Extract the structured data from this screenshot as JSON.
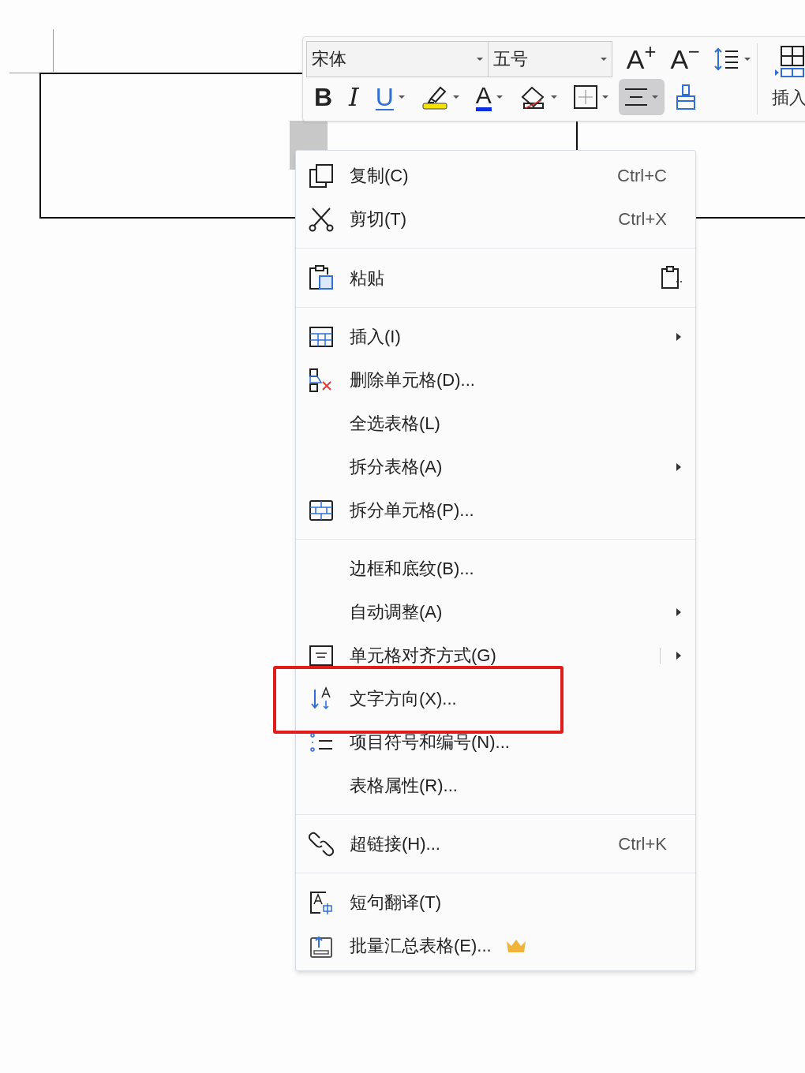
{
  "toolbar": {
    "font": {
      "value": "宋体"
    },
    "size": {
      "value": "五号"
    },
    "row1": [
      {
        "kind": "grow_font",
        "glyph": "A$^{+}$",
        "dropdown": false,
        "selected": false
      },
      {
        "kind": "shrink_font",
        "glyph": "A$^{−}$",
        "dropdown": false,
        "selected": false
      },
      {
        "kind": "line_spacing",
        "dropdown": true,
        "selected": false
      }
    ],
    "row2": [
      {
        "kind": "bold",
        "glyph": "B",
        "dropdown": false,
        "selected": false
      },
      {
        "kind": "italic",
        "glyph": "I",
        "dropdown": false,
        "selected": false
      },
      {
        "kind": "underline",
        "glyph": "U",
        "dropdown": true,
        "selected": false
      },
      {
        "kind": "highlight",
        "dropdown": true,
        "selected": false
      },
      {
        "kind": "font_color",
        "glyph": "A",
        "dropdown": true,
        "selected": false
      },
      {
        "kind": "clear_format",
        "dropdown": true,
        "selected": false
      },
      {
        "kind": "borders",
        "dropdown": true,
        "selected": false
      },
      {
        "kind": "align",
        "dropdown": true,
        "selected": true
      },
      {
        "kind": "format_painter",
        "dropdown": false,
        "selected": false
      }
    ],
    "insert": {
      "label": "插入"
    }
  },
  "menu": [
    {
      "kind": "copy",
      "label": "复制(C)",
      "shortcut": "Ctrl+C"
    },
    {
      "kind": "cut",
      "label": "剪切(T)",
      "shortcut": "Ctrl+X"
    },
    {
      "kind": "separator"
    },
    {
      "kind": "paste",
      "label": "粘贴",
      "paste_options": true
    },
    {
      "kind": "separator"
    },
    {
      "kind": "insert_table",
      "label": "插入(I)",
      "submenu": true
    },
    {
      "kind": "delete_cells",
      "label": "删除单元格(D)..."
    },
    {
      "kind": "plain",
      "label": "全选表格(L)"
    },
    {
      "kind": "plain",
      "label": "拆分表格(A)",
      "submenu": true
    },
    {
      "kind": "split_cells",
      "label": "拆分单元格(P)..."
    },
    {
      "kind": "separator"
    },
    {
      "kind": "plain",
      "label": "边框和底纹(B)..."
    },
    {
      "kind": "plain",
      "label": "自动调整(A)",
      "submenu": true
    },
    {
      "kind": "cell_align",
      "label": "单元格对齐方式(G)",
      "submenu": true,
      "split": true
    },
    {
      "kind": "text_direction",
      "label": "文字方向(X)...",
      "annotated": true
    },
    {
      "kind": "bullets",
      "label": "项目符号和编号(N)..."
    },
    {
      "kind": "plain",
      "label": "表格属性(R)..."
    },
    {
      "kind": "separator"
    },
    {
      "kind": "link",
      "label": "超链接(H)...",
      "shortcut": "Ctrl+K"
    },
    {
      "kind": "separator"
    },
    {
      "kind": "translate",
      "label": "短句翻译(T)"
    },
    {
      "kind": "batch",
      "label": "批量汇总表格(E)...",
      "premium": true
    }
  ]
}
